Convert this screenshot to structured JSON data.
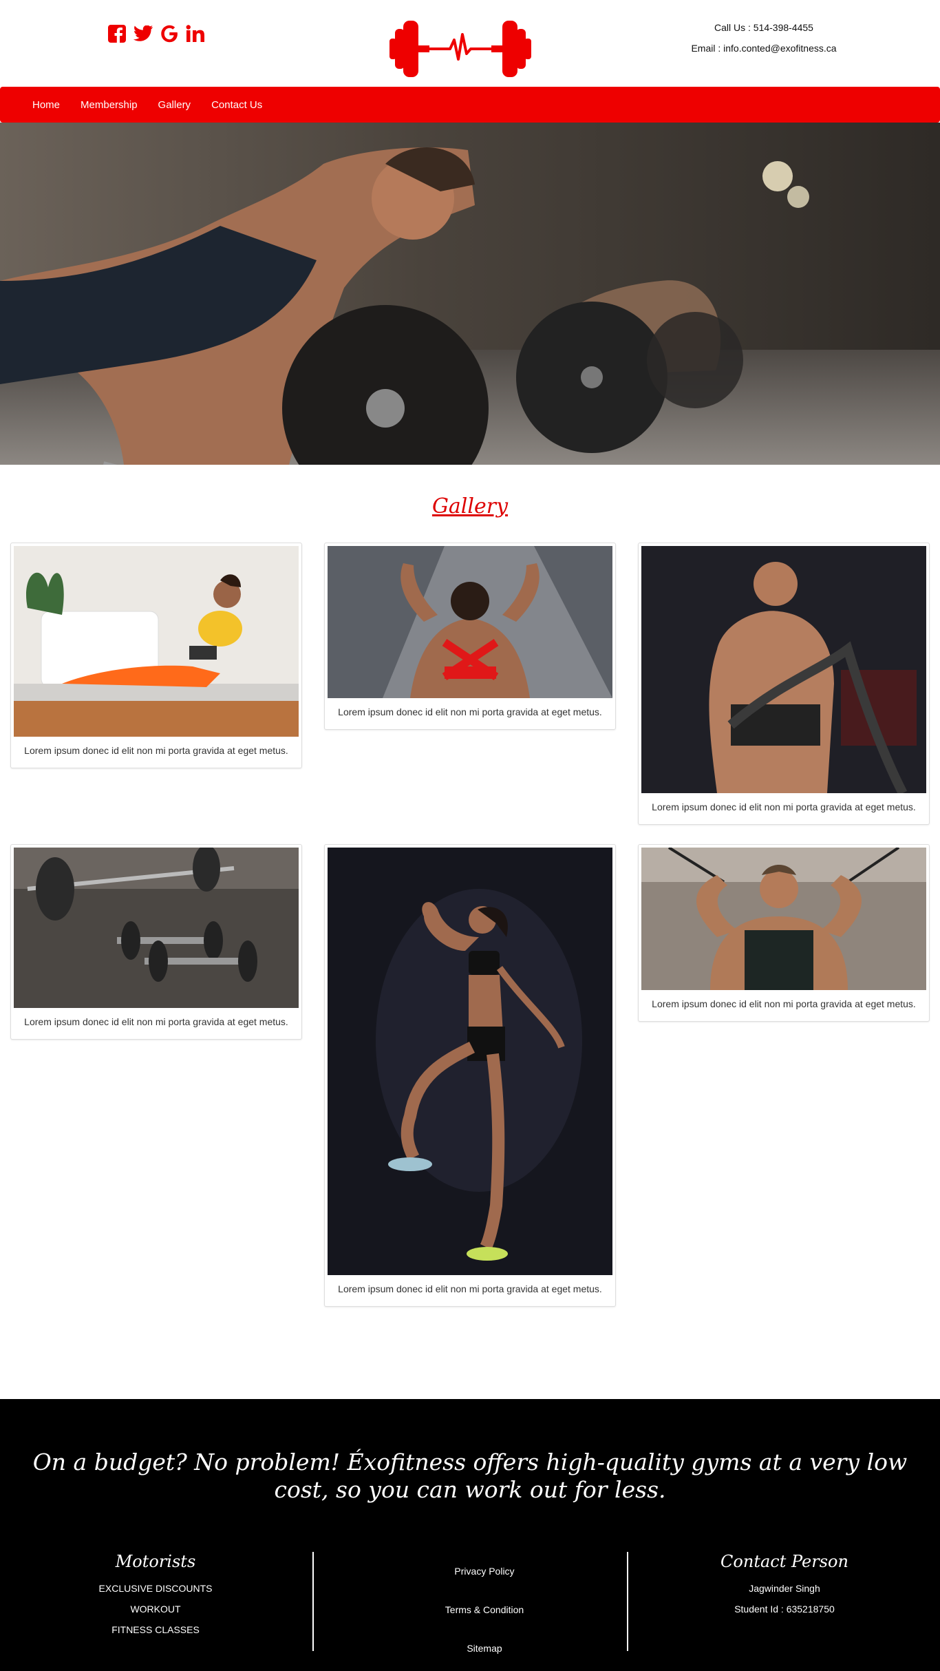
{
  "header": {
    "social": [
      {
        "name": "facebook-icon"
      },
      {
        "name": "twitter-icon"
      },
      {
        "name": "google-icon"
      },
      {
        "name": "linkedin-icon"
      }
    ],
    "call": "Call Us : 514-398-4455",
    "email": "Email : info.conted@exofitness.ca"
  },
  "nav": {
    "items": [
      "Home",
      "Membership",
      "Gallery",
      "Contact Us"
    ]
  },
  "gallery": {
    "title": "Gallery",
    "captions": [
      "Lorem ipsum donec id elit non mi porta gravida at eget metus.",
      "Lorem ipsum donec id elit non mi porta gravida at eget metus.",
      "Lorem ipsum donec id elit non mi porta gravida at eget metus.",
      "Lorem ipsum donec id elit non mi porta gravida at eget metus.",
      "Lorem ipsum donec id elit non mi porta gravida at eget metus.",
      "Lorem ipsum donec id elit non mi porta gravida at eget metus."
    ]
  },
  "footer": {
    "tagline": "On a budget?  No problem! Éxofitness offers high-quality gyms at a very low cost, so you can work out for less.",
    "motorists": {
      "title": "Motorists",
      "items": [
        "EXCLUSIVE DISCOUNTS",
        "WORKOUT",
        "FITNESS CLASSES"
      ]
    },
    "links": [
      "Privacy Policy",
      "Terms & Condition",
      "Sitemap"
    ],
    "contact": {
      "title": "Contact Person",
      "name": "Jagwinder Singh",
      "student": "Student Id : 635218750"
    }
  },
  "colors": {
    "brand_red": "#ee0000",
    "footer_bg": "#000000"
  }
}
